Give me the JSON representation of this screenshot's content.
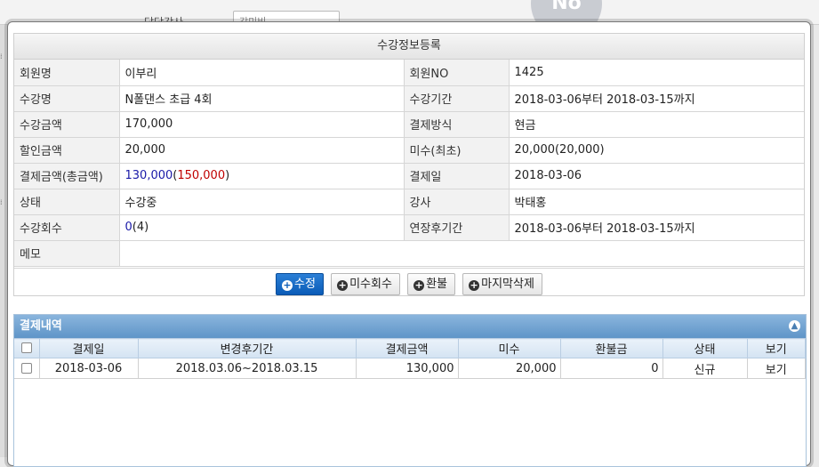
{
  "background": {
    "label": "담당강사",
    "select_value": "강미비",
    "avatar_text": "No"
  },
  "modal": {
    "panel_title": "수강정보등록",
    "rows": [
      {
        "l1": "회원명",
        "v1": "이부리",
        "l2": "회원NO",
        "v2": "1425"
      },
      {
        "l1": "수강명",
        "v1": "N폴댄스 초급 4회",
        "l2": "수강기간",
        "v2": "2018-03-06부터 2018-03-15까지"
      },
      {
        "l1": "수강금액",
        "v1": "170,000",
        "l2": "결제방식",
        "v2": "현금"
      },
      {
        "l1": "할인금액",
        "v1": "20,000",
        "l2": "미수(최초)",
        "v2": "20,000(20,000)"
      },
      {
        "l1": "결제금액(총금액)",
        "v1a": "130,000",
        "v1b": "(",
        "v1c": "150,000",
        "v1d": ")",
        "l2": "결제일",
        "v2": "2018-03-06"
      },
      {
        "l1": "상태",
        "v1": "수강중",
        "l2": "강사",
        "v2": "박태홍"
      },
      {
        "l1": "수강회수",
        "v1a": "0",
        "v1b": "(4)",
        "l2": "연장후기간",
        "v2": "2018-03-06부터 2018-03-15까지"
      },
      {
        "l1": "메모",
        "v1": ""
      }
    ],
    "buttons": {
      "edit": "수정",
      "collect": "미수회수",
      "refund": "환불",
      "delete_last": "마지막삭제"
    }
  },
  "payments": {
    "title": "결제내역",
    "columns": [
      "결제일",
      "변경후기간",
      "결제금액",
      "미수",
      "환불금",
      "상태",
      "보기"
    ],
    "rows": [
      {
        "date": "2018-03-06",
        "period": "2018.03.06~2018.03.15",
        "amount": "130,000",
        "unpaid": "20,000",
        "refund": "0",
        "status": "신규",
        "view": "보기"
      }
    ]
  },
  "colors": {
    "primary_button": "#0b5cb7",
    "panel_header": "#5f95c8",
    "total_amount": "#1a1aa8",
    "gross_amount": "#c00000"
  }
}
